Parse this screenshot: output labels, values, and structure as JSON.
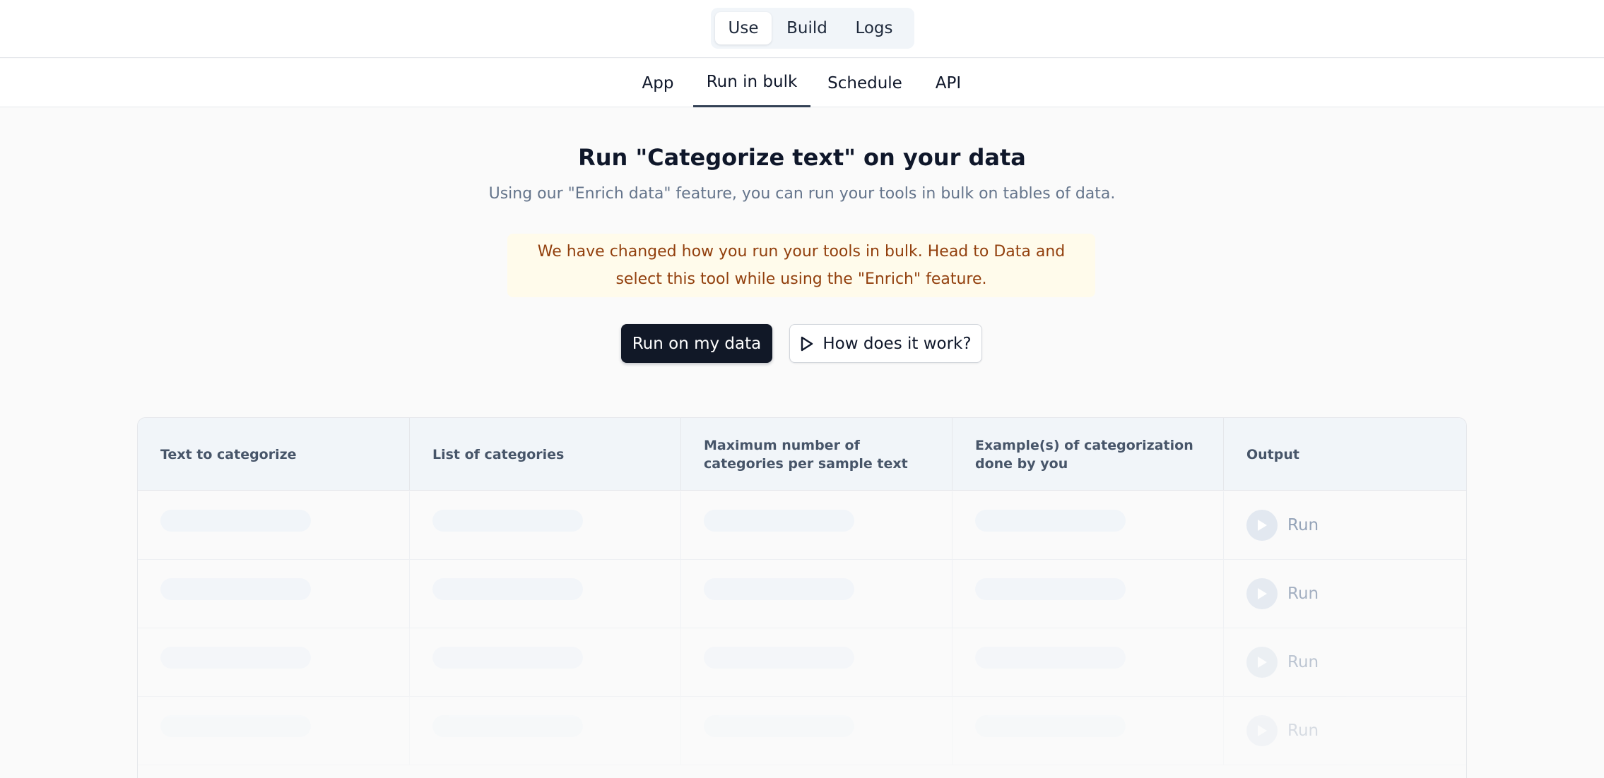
{
  "mode_switcher": {
    "items": [
      "Use",
      "Build",
      "Logs"
    ],
    "active": "Use"
  },
  "sub_tabs": {
    "items": [
      "App",
      "Run in bulk",
      "Schedule",
      "API"
    ],
    "active": "Run in bulk"
  },
  "main": {
    "title": "Run \"Categorize text\" on your data",
    "subtitle": "Using our \"Enrich data\" feature, you can run your tools in bulk on tables of data.",
    "notice": "We have changed how you run your tools in bulk. Head to Data and select this tool while using the \"Enrich\" feature.",
    "primary_button": "Run on my data",
    "secondary_button": "How does it work?"
  },
  "table": {
    "headers": [
      "Text to categorize",
      "List of categories",
      "Maximum number of categories per sample text",
      "Example(s) of categorization done by you",
      "Output"
    ],
    "rows": [
      {
        "action": "Run"
      },
      {
        "action": "Run"
      },
      {
        "action": "Run"
      },
      {
        "action": "Run"
      }
    ]
  },
  "icons": {
    "how_it_works": "play-outline-icon",
    "run": "play-icon"
  },
  "colors": {
    "primary_button": "#111827",
    "notice_bg": "#fffbeb",
    "notice_text": "#92400e",
    "muted_text": "#64748b",
    "run_disabled": "#94a3b8"
  }
}
